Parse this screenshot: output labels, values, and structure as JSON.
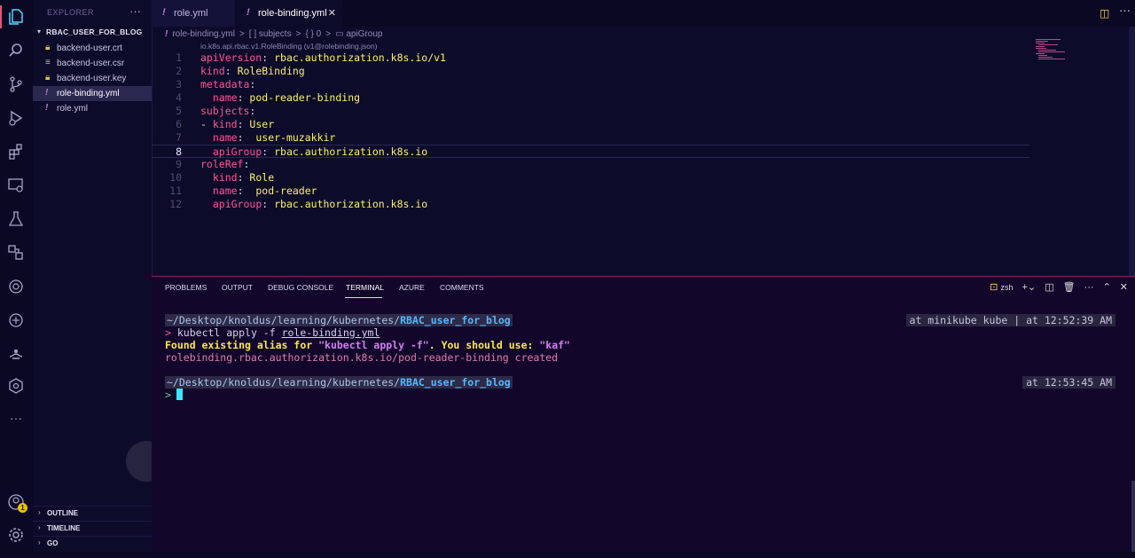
{
  "sidebar": {
    "explorer_title": "EXPLORER",
    "folder": "RBAC_USER_FOR_BLOG",
    "files": [
      {
        "name": "backend-user.crt",
        "icon": "lock-icon"
      },
      {
        "name": "backend-user.csr",
        "icon": "lines-icon"
      },
      {
        "name": "backend-user.key",
        "icon": "lock-icon"
      },
      {
        "name": "role-binding.yml",
        "icon": "exclamation-icon",
        "active": true
      },
      {
        "name": "role.yml",
        "icon": "exclamation-icon"
      }
    ],
    "sections": [
      "OUTLINE",
      "TIMELINE",
      "GO"
    ]
  },
  "activity": {
    "badge_count": "1",
    "icons": [
      "files-icon",
      "search-icon",
      "source-control-icon",
      "run-debug-icon",
      "extensions-icon",
      "remote-explorer-icon",
      "testing-icon",
      "containers-icon",
      "openai-icon",
      "chatgpt-icon",
      "genie-icon",
      "kubernetes-icon",
      "more-icon",
      "accounts-icon",
      "settings-icon"
    ]
  },
  "tabs": [
    {
      "label": "role.yml",
      "active": false
    },
    {
      "label": "role-binding.yml",
      "active": true
    }
  ],
  "breadcrumb": {
    "file": "role-binding.yml",
    "sep": ">",
    "items": [
      "[ ] subjects",
      "{ } 0",
      "apiGroup"
    ]
  },
  "editor": {
    "schema_hint": "io.k8s.api.rbac.v1.RoleBinding (v1@rolebinding.json)",
    "current_line": 8,
    "lines": [
      {
        "n": "1",
        "indent": "",
        "dash": "",
        "key": "apiVersion",
        "sep": ": ",
        "val": "rbac.authorization.k8s.io/v1"
      },
      {
        "n": "2",
        "indent": "",
        "dash": "",
        "key": "kind",
        "sep": ": ",
        "val": "RoleBinding"
      },
      {
        "n": "3",
        "indent": "",
        "dash": "",
        "key": "metadata",
        "sep": ":",
        "val": ""
      },
      {
        "n": "4",
        "indent": "  ",
        "dash": "",
        "key": "name",
        "sep": ": ",
        "val": "pod-reader-binding"
      },
      {
        "n": "5",
        "indent": "",
        "dash": "",
        "key": "subjects",
        "sep": ":",
        "val": ""
      },
      {
        "n": "6",
        "indent": "",
        "dash": "- ",
        "key": "kind",
        "sep": ": ",
        "val": "User"
      },
      {
        "n": "7",
        "indent": "  ",
        "dash": "",
        "key": "name",
        "sep": ":  ",
        "val": "user-muzakkir"
      },
      {
        "n": "8",
        "indent": "  ",
        "dash": "",
        "key": "apiGroup",
        "sep": ": ",
        "val": "rbac.authorization.k8s.io"
      },
      {
        "n": "9",
        "indent": "",
        "dash": "",
        "key": "roleRef",
        "sep": ":",
        "val": ""
      },
      {
        "n": "10",
        "indent": "  ",
        "dash": "",
        "key": "kind",
        "sep": ": ",
        "val": "Role"
      },
      {
        "n": "11",
        "indent": "  ",
        "dash": "",
        "key": "name",
        "sep": ":  ",
        "val": "pod-reader"
      },
      {
        "n": "12",
        "indent": "  ",
        "dash": "",
        "key": "apiGroup",
        "sep": ": ",
        "val": "rbac.authorization.k8s.io"
      }
    ]
  },
  "panel": {
    "tabs": [
      "PROBLEMS",
      "OUTPUT",
      "DEBUG CONSOLE",
      "TERMINAL",
      "AZURE",
      "COMMENTS"
    ],
    "active_tab": "TERMINAL",
    "shell": "zsh"
  },
  "terminal": {
    "path_prefix": "~/Desktop/knoldus/learning/kubernetes/",
    "path_dir": "RBAC_user_for_blog",
    "right_prompt_1": "at minikube kube | at 12:52:39 AM",
    "right_prompt_2": "at 12:53:45 AM",
    "prompt_char": ">",
    "cmd_pre": "kubectl apply -f ",
    "cmd_file": "role-binding.yml",
    "warn_pre": "Found existing alias for ",
    "warn_cmd": "\"kubectl apply -f\"",
    "warn_mid": ". You should use: ",
    "warn_alias": "\"kaf\"",
    "output": "rolebinding.rbac.authorization.k8s.io/pod-reader-binding created"
  },
  "colors": {
    "background": "#0d0b2a",
    "key": "#ff5596",
    "value": "#fbf06b",
    "accent": "#e5527c",
    "cursor": "#3ee5ff"
  }
}
